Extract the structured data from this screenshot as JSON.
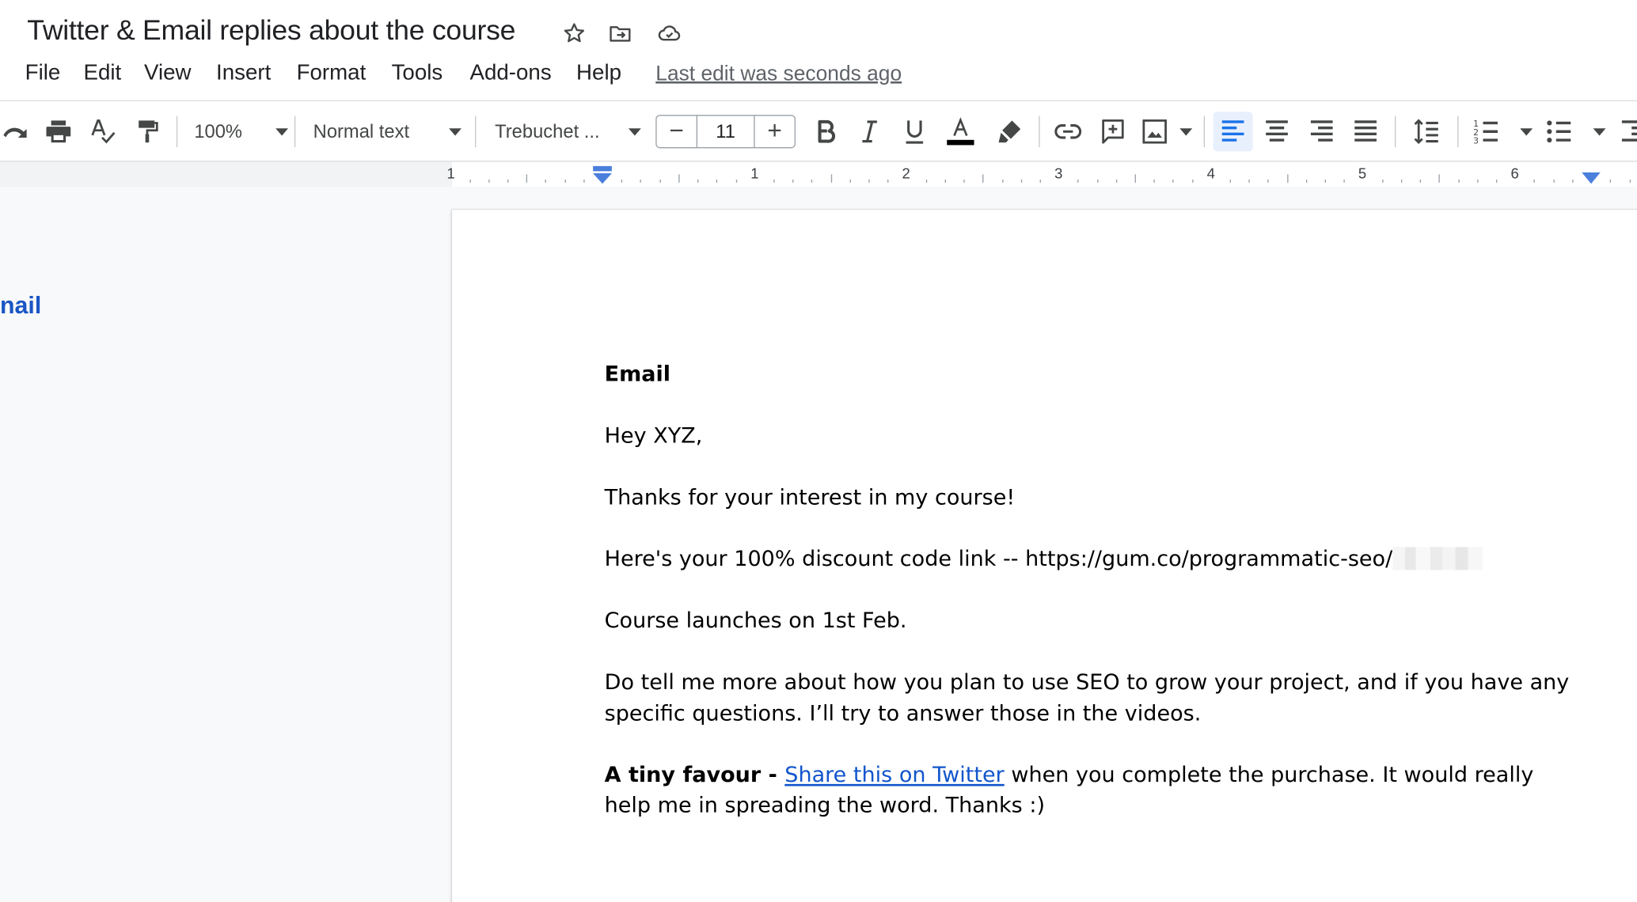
{
  "doc": {
    "title": "Twitter & Email replies about the course"
  },
  "icons": {
    "star": "star-icon",
    "move": "move-to-folder-icon",
    "cloud": "cloud-saved-icon"
  },
  "menu": {
    "items": [
      "File",
      "Edit",
      "View",
      "Insert",
      "Format",
      "Tools",
      "Add-ons",
      "Help"
    ],
    "last_edit": "Last edit was seconds ago"
  },
  "toolbar": {
    "zoom": "100%",
    "style": "Normal text",
    "font": "Trebuchet ...",
    "font_size": "11",
    "minus": "−",
    "plus": "+"
  },
  "ruler": {
    "labels": [
      "1",
      "1",
      "2",
      "3",
      "4",
      "5",
      "6"
    ]
  },
  "outline": {
    "visible_text": "nail"
  },
  "body": {
    "heading": "Email",
    "greeting": "Hey XYZ,",
    "thanks": "Thanks for your interest in my course!",
    "discount": "Here's your 100% discount code link -- https://gum.co/programmatic-seo/",
    "launch": "Course launches on 1st Feb.",
    "tell_more": "Do tell me more about how you plan to use SEO to grow your project, and if you have any specific questions. I’ll try to answer those in the videos.",
    "favour_bold": "A tiny favour - ",
    "favour_link": "Share this on Twitter",
    "favour_rest": " when you complete the purchase. It would really help me in spreading the word. Thanks :)"
  },
  "colors": {
    "link": "#1155cc",
    "outline_heading": "#1a56c4",
    "active_align_bg": "#e8f0fe",
    "ruler_marker": "#4a7fdc"
  }
}
